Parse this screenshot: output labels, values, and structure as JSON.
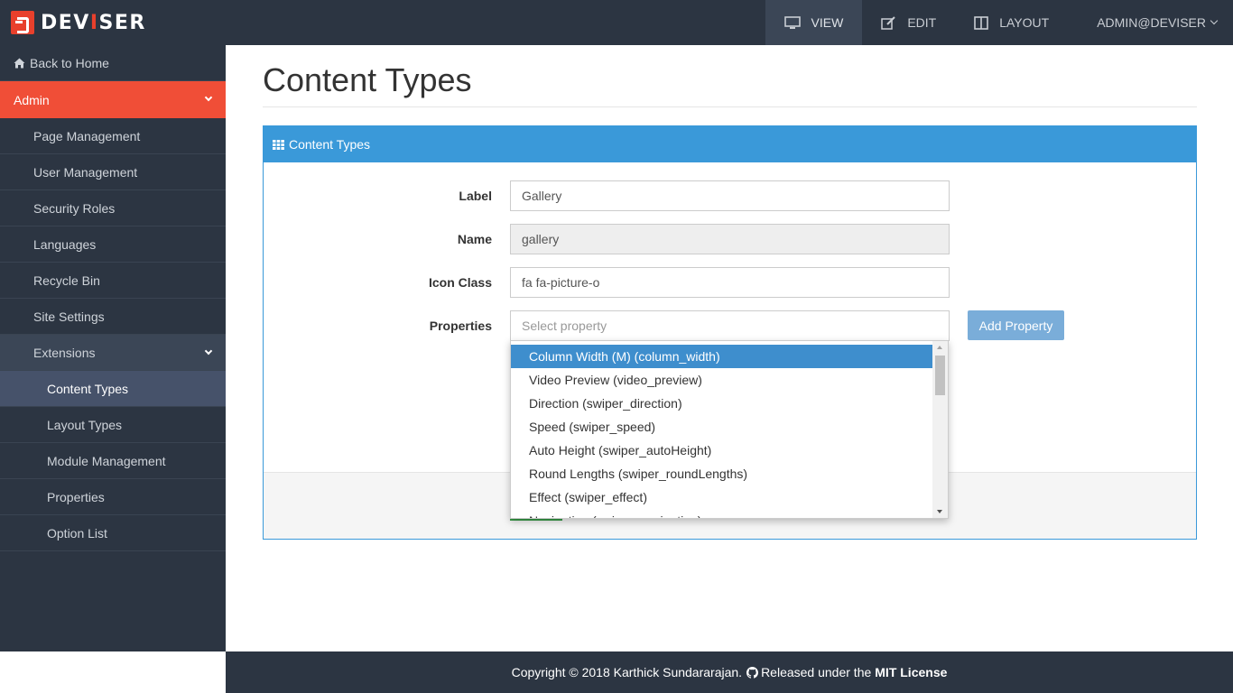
{
  "brand": {
    "prefix": "DEV",
    "highlight": "I",
    "suffix": "SER"
  },
  "topnav": {
    "view": "VIEW",
    "edit": "EDIT",
    "layout": "LAYOUT",
    "user": "ADMIN@DEVISER"
  },
  "sidebar": {
    "back": "Back to Home",
    "admin": "Admin",
    "items": [
      "Page Management",
      "User Management",
      "Security Roles",
      "Languages",
      "Recycle Bin",
      "Site Settings"
    ],
    "extensions": "Extensions",
    "sub_items": [
      "Content Types",
      "Layout Types",
      "Module Management",
      "Properties",
      "Option List"
    ]
  },
  "page": {
    "title": "Content Types"
  },
  "panel": {
    "title": "Content Types"
  },
  "form": {
    "label_label": "Label",
    "label_value": "Gallery",
    "name_label": "Name",
    "name_value": "gallery",
    "icon_label": "Icon Class",
    "icon_value": "fa fa-picture-o",
    "props_label": "Properties",
    "props_placeholder": "Select property",
    "add_button": "Add Property"
  },
  "dropdown": {
    "options": [
      "Column Width (M) (column_width)",
      "Video Preview (video_preview)",
      "Direction (swiper_direction)",
      "Speed (swiper_speed)",
      "Auto Height (swiper_autoHeight)",
      "Round Lengths (swiper_roundLengths)",
      "Effect (swiper_effect)",
      "Navigation (swiper_navigation)"
    ]
  },
  "footer": {
    "copyright": "Copyright © 2018 Karthick Sundararajan.",
    "released": "Released under the",
    "license": "MIT License"
  },
  "colors": {
    "accent": "#f04e37",
    "panel": "#3a99d9",
    "dark": "#2c3542"
  }
}
